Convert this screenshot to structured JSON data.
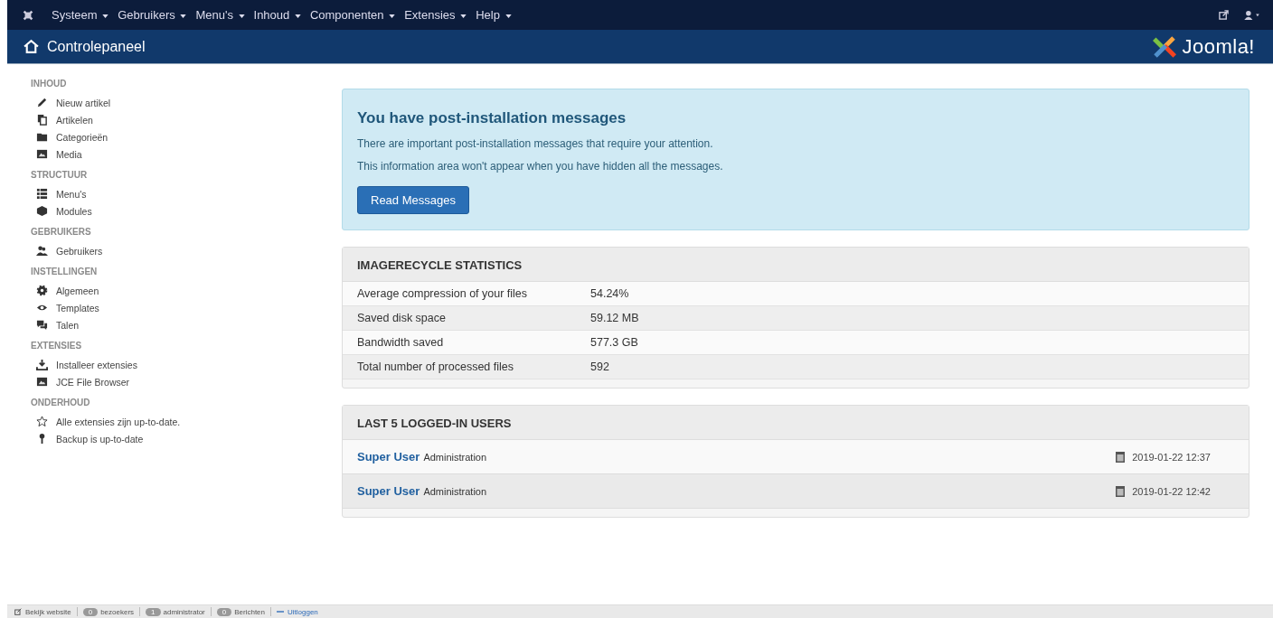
{
  "menu": [
    {
      "label": "Systeem"
    },
    {
      "label": "Gebruikers"
    },
    {
      "label": "Menu's"
    },
    {
      "label": "Inhoud"
    },
    {
      "label": "Componenten"
    },
    {
      "label": "Extensies"
    },
    {
      "label": "Help"
    }
  ],
  "page_title": "Controlepaneel",
  "logo_text": "Joomla!",
  "sidebar": [
    {
      "heading": "INHOUD",
      "items": [
        {
          "label": "Nieuw artikel",
          "kind": "pencil"
        },
        {
          "label": "Artikelen",
          "kind": "copy"
        },
        {
          "label": "Categorieën",
          "kind": "folder"
        },
        {
          "label": "Media",
          "kind": "image"
        }
      ]
    },
    {
      "heading": "STRUCTUUR",
      "items": [
        {
          "label": "Menu's",
          "kind": "list"
        },
        {
          "label": "Modules",
          "kind": "cube"
        }
      ]
    },
    {
      "heading": "GEBRUIKERS",
      "items": [
        {
          "label": "Gebruikers",
          "kind": "users"
        }
      ]
    },
    {
      "heading": "INSTELLINGEN",
      "items": [
        {
          "label": "Algemeen",
          "kind": "gear"
        },
        {
          "label": "Templates",
          "kind": "eye"
        },
        {
          "label": "Talen",
          "kind": "chat"
        }
      ]
    },
    {
      "heading": "EXTENSIES",
      "items": [
        {
          "label": "Installeer extensies",
          "kind": "download"
        },
        {
          "label": "JCE File Browser",
          "kind": "image"
        }
      ]
    },
    {
      "heading": "ONDERHOUD",
      "items": [
        {
          "label": "Alle extensies zijn up-to-date.",
          "kind": "star"
        },
        {
          "label": "Backup is up-to-date",
          "kind": "pin"
        }
      ]
    }
  ],
  "alert": {
    "title": "You have post-installation messages",
    "lines": [
      "There are important post-installation messages that require your attention.",
      "This information area won't appear when you have hidden all the messages."
    ],
    "button": "Read Messages"
  },
  "stats": {
    "title": "IMAGERECYCLE STATISTICS",
    "rows": [
      {
        "label": "Average compression of your files",
        "value": "54.24%"
      },
      {
        "label": "Saved disk space",
        "value": "59.12 MB"
      },
      {
        "label": "Bandwidth saved",
        "value": "577.3 GB"
      },
      {
        "label": "Total number of processed files",
        "value": "592"
      }
    ]
  },
  "users": {
    "title": "LAST 5 LOGGED-IN USERS",
    "rows": [
      {
        "name": "Super User",
        "role": "Administration",
        "time": "2019-01-22 12:37"
      },
      {
        "name": "Super User",
        "role": "Administration",
        "time": "2019-01-22 12:42"
      }
    ]
  },
  "footer": [
    {
      "label": "Bekijk website",
      "kind": "link"
    },
    {
      "count": "0",
      "label": "bezoekers",
      "kind": "badge"
    },
    {
      "count": "1",
      "label": "administrator",
      "kind": "badge"
    },
    {
      "count": "0",
      "label": "Berichten",
      "kind": "badge"
    },
    {
      "label": "Uitloggen",
      "kind": "logout"
    }
  ]
}
